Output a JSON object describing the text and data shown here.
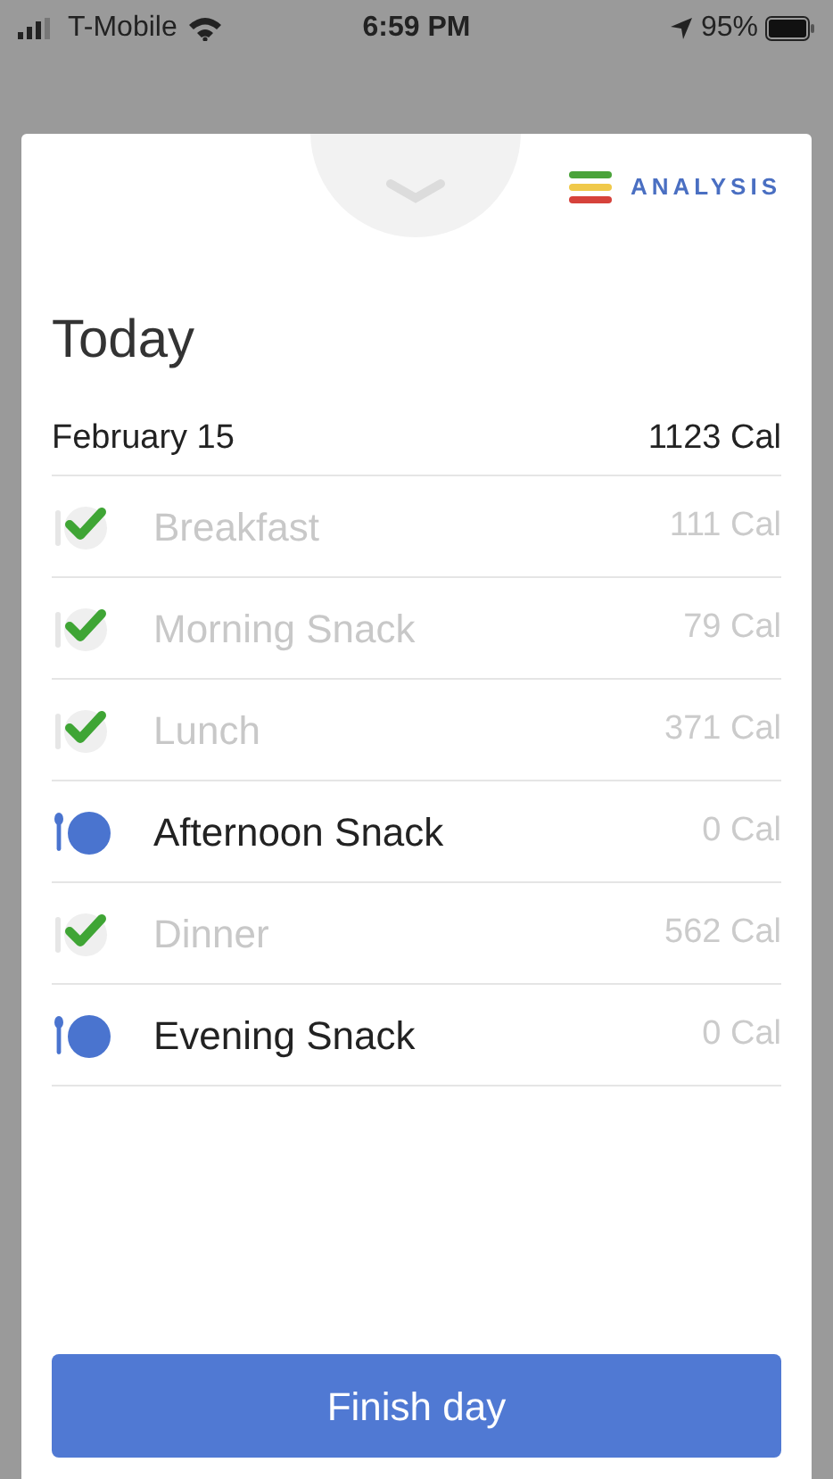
{
  "status_bar": {
    "carrier": "T-Mobile",
    "time": "6:59 PM",
    "battery": "95%"
  },
  "analysis_button": {
    "label": "ANALYSIS"
  },
  "title": "Today",
  "date": "February 15",
  "total": "1123 Cal",
  "meals": [
    {
      "name": "Breakfast",
      "calories": "111 Cal",
      "done": true
    },
    {
      "name": "Morning Snack",
      "calories": "79 Cal",
      "done": true
    },
    {
      "name": "Lunch",
      "calories": "371 Cal",
      "done": true
    },
    {
      "name": "Afternoon Snack",
      "calories": "0 Cal",
      "done": false
    },
    {
      "name": "Dinner",
      "calories": "562 Cal",
      "done": true
    },
    {
      "name": "Evening Snack",
      "calories": "0 Cal",
      "done": false
    }
  ],
  "finish_button": {
    "label": "Finish day"
  }
}
